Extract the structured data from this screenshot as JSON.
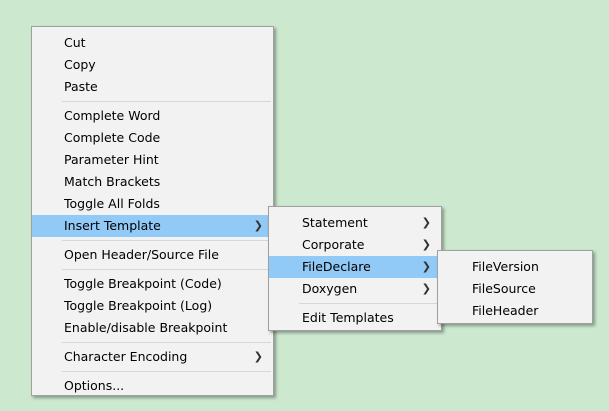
{
  "main_menu": {
    "cut": "Cut",
    "copy": "Copy",
    "paste": "Paste",
    "complete_word": "Complete Word",
    "complete_code": "Complete Code",
    "parameter_hint": "Parameter Hint",
    "match_brackets": "Match Brackets",
    "toggle_all_folds": "Toggle All Folds",
    "insert_template": "Insert Template",
    "open_header_source": "Open Header/Source File",
    "toggle_breakpoint_code": "Toggle Breakpoint (Code)",
    "toggle_breakpoint_log": "Toggle Breakpoint (Log)",
    "enable_disable_breakpoint": "Enable/disable Breakpoint",
    "character_encoding": "Character Encoding",
    "options": "Options..."
  },
  "template_submenu": {
    "statement": "Statement",
    "corporate": "Corporate",
    "filedeclare": "FileDeclare",
    "doxygen": "Doxygen",
    "edit_templates": "Edit Templates"
  },
  "filedeclare_submenu": {
    "fileversion": "FileVersion",
    "filesource": "FileSource",
    "fileheader": "FileHeader"
  },
  "icons": {
    "submenu_arrow": "chevron-right-icon"
  },
  "colors": {
    "background": "#cce8cf",
    "menu_bg": "#f2f2f2",
    "highlight": "#91c9f7"
  }
}
